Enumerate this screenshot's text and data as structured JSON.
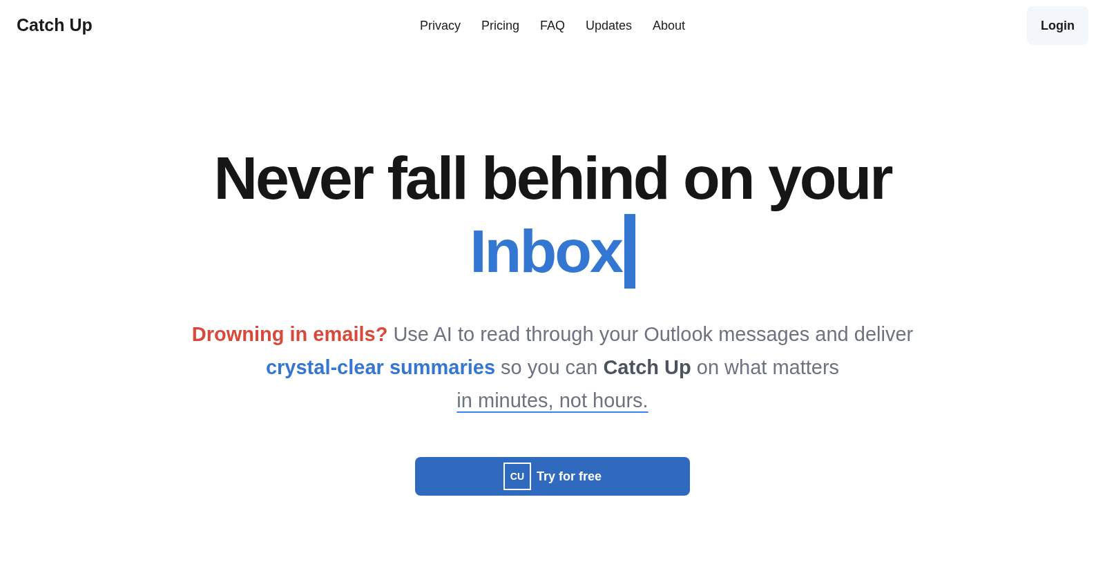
{
  "brand": "Catch Up",
  "nav": [
    {
      "label": "Privacy"
    },
    {
      "label": "Pricing"
    },
    {
      "label": "FAQ"
    },
    {
      "label": "Updates"
    },
    {
      "label": "About"
    }
  ],
  "login": "Login",
  "headline": {
    "line1": "Never fall behind on your",
    "highlight": "Inbox"
  },
  "intro": [
    {
      "kind": "alert",
      "text": "Drowning in emails?"
    },
    {
      "kind": "plain",
      "text": " Use AI to read through your Outlook messages and deliver "
    },
    {
      "kind": "highlight",
      "text": "crystal-clear summaries"
    },
    {
      "kind": "plain",
      "text": " so you can "
    },
    {
      "kind": "strong",
      "text": "Catch Up"
    },
    {
      "kind": "plain",
      "text": " on what matters "
    },
    {
      "kind": "link",
      "text": "in minutes, not hours."
    }
  ],
  "cta": {
    "logo": "CU",
    "label": "Try for free"
  }
}
